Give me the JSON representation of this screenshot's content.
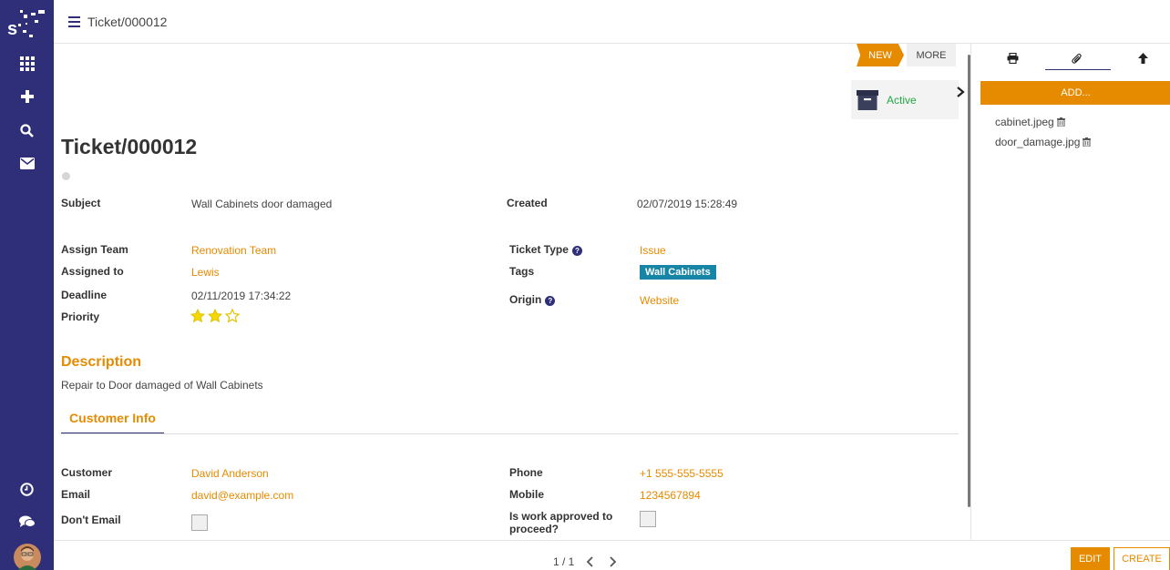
{
  "topbar": {
    "breadcrumb": "Ticket/000012"
  },
  "statusbar": {
    "new_label": "NEW",
    "more_label": "MORE"
  },
  "active_button": {
    "label": "Active"
  },
  "record": {
    "title": "Ticket/000012"
  },
  "fields": {
    "subject_label": "Subject",
    "subject": "Wall Cabinets door damaged",
    "created_label": "Created",
    "created": "02/07/2019 15:28:49",
    "assign_team_label": "Assign Team",
    "assign_team": "Renovation Team",
    "assigned_to_label": "Assigned to",
    "assigned_to": "Lewis",
    "deadline_label": "Deadline",
    "deadline": "02/11/2019 17:34:22",
    "priority_label": "Priority",
    "priority_value": 2,
    "priority_max": 3,
    "ticket_type_label": "Ticket Type",
    "ticket_type": "Issue",
    "tags_label": "Tags",
    "tag": "Wall Cabinets",
    "origin_label": "Origin",
    "origin": "Website"
  },
  "description": {
    "title": "Description",
    "text": "Repair to Door damaged of Wall Cabinets"
  },
  "tabs": {
    "customer_info": "Customer Info"
  },
  "customer": {
    "customer_label": "Customer",
    "customer": "David Anderson",
    "email_label": "Email",
    "email": "david@example.com",
    "dont_email_label": "Don't Email",
    "phone_label": "Phone",
    "phone": "+1 555-555-5555",
    "mobile_label": "Mobile",
    "mobile": "1234567894",
    "approved_label_1": "Is work approved to",
    "approved_label_2": "proceed?"
  },
  "attachments": {
    "add_label": "ADD...",
    "files": [
      "cabinet.jpeg",
      "door_damage.jpg"
    ]
  },
  "pager": {
    "text": "1 / 1"
  },
  "actions": {
    "edit": "EDIT",
    "create": "CREATE"
  },
  "colors": {
    "rail": "#2e2f78",
    "accent": "#e68a00",
    "tag": "#1785a6",
    "active": "#22a845"
  },
  "icons": [
    "logo-icon",
    "apps-grid-icon",
    "plus-icon",
    "search-icon",
    "mail-icon",
    "clock-icon",
    "chat-icon",
    "user-avatar",
    "printer-icon",
    "paperclip-icon",
    "arrow-up-icon",
    "trash-icon",
    "archive-box-icon",
    "chevron-right-icon",
    "chevron-left-icon",
    "star-icon",
    "help-icon"
  ]
}
